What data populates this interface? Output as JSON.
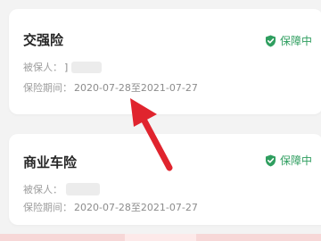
{
  "colors": {
    "accent_green": "#2f9e5f",
    "arrow_red": "#e0242e"
  },
  "policies": [
    {
      "title": "交强险",
      "status": "保障中",
      "status_icon": "shield-check-icon",
      "insured_label": "被保人：",
      "insured_value": "]",
      "period_label": "保险期间：",
      "period_value": "2020-07-28至2021-07-27"
    },
    {
      "title": "商业车险",
      "status": "保障中",
      "status_icon": "shield-check-icon",
      "insured_label": "被保人：",
      "insured_value": "",
      "period_label": "保险期间：",
      "period_value": "2020-07-28至2021-07-27"
    }
  ],
  "annotation": {
    "icon": "red-arrow-icon"
  }
}
